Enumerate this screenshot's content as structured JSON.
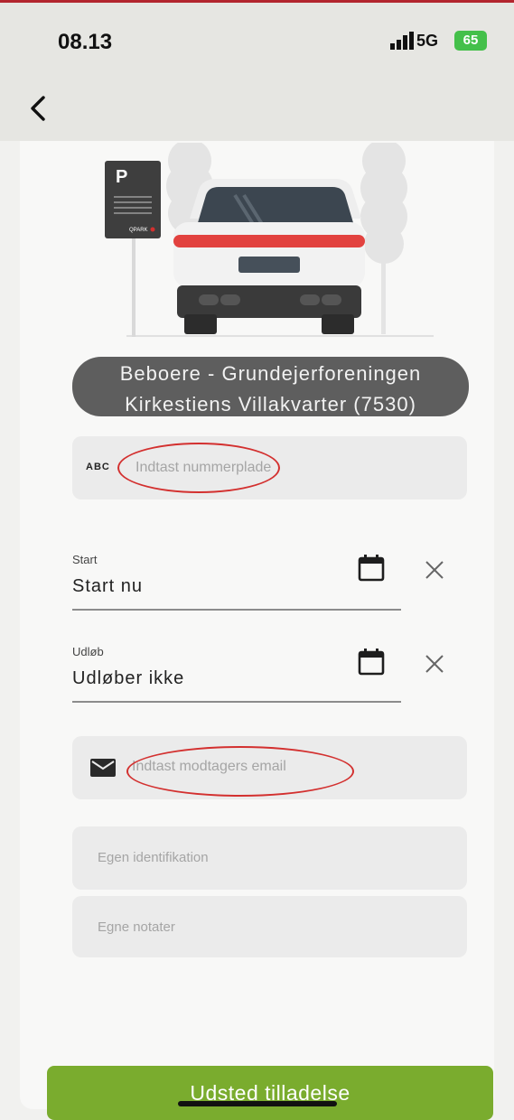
{
  "status_bar": {
    "time": "08.13",
    "network": "5G",
    "battery": "65"
  },
  "nav": {
    "back_icon": "chevron-left-icon"
  },
  "illustration": {
    "sign_letter": "P",
    "sign_side_text": "Q-INFO",
    "sign_brand": "QPARK",
    "icon": "parked-car-illustration"
  },
  "permit": {
    "lot_name_line1": "Beboere - Grundejerforeningen",
    "lot_name_line2": "Kirkestiens Villakvarter (7530)"
  },
  "plate": {
    "badge": "ABC",
    "placeholder": "Indtast nummerplade"
  },
  "start": {
    "label": "Start",
    "value": "Start nu"
  },
  "expiry": {
    "label": "Udløb",
    "value": "Udløber ikke"
  },
  "email": {
    "placeholder": "Indtast modtagers email",
    "icon": "envelope-icon"
  },
  "own_id": {
    "placeholder": "Egen identifikation"
  },
  "notes": {
    "placeholder": "Egne notater"
  },
  "submit": {
    "label": "Udsted tilladelse"
  },
  "colors": {
    "accent": "#7aac2e",
    "annotation": "#d3302f",
    "battery": "#44c04a"
  }
}
